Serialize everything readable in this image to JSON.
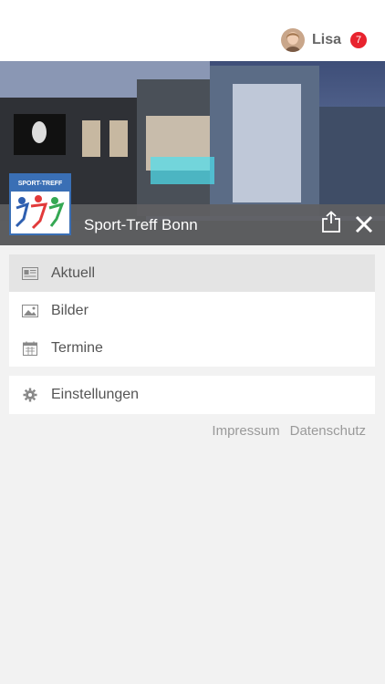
{
  "user": {
    "name": "Lisa",
    "notification_count": "7"
  },
  "header": {
    "title": "Sport-Treff Bonn",
    "logo_text": "SPORT-TREFF"
  },
  "menu": {
    "items": [
      {
        "label": "Aktuell",
        "icon": "newspaper-icon",
        "active": true
      },
      {
        "label": "Bilder",
        "icon": "image-icon",
        "active": false
      },
      {
        "label": "Termine",
        "icon": "calendar-icon",
        "active": false
      }
    ]
  },
  "settings": {
    "label": "Einstellungen",
    "icon": "gear-icon"
  },
  "footer": {
    "impressum": "Impressum",
    "datenschutz": "Datenschutz"
  },
  "colors": {
    "badge": "#e8232e",
    "strip": "#5f5f62",
    "active_item": "#e4e4e4",
    "logo_blue": "#3a6fb5"
  }
}
